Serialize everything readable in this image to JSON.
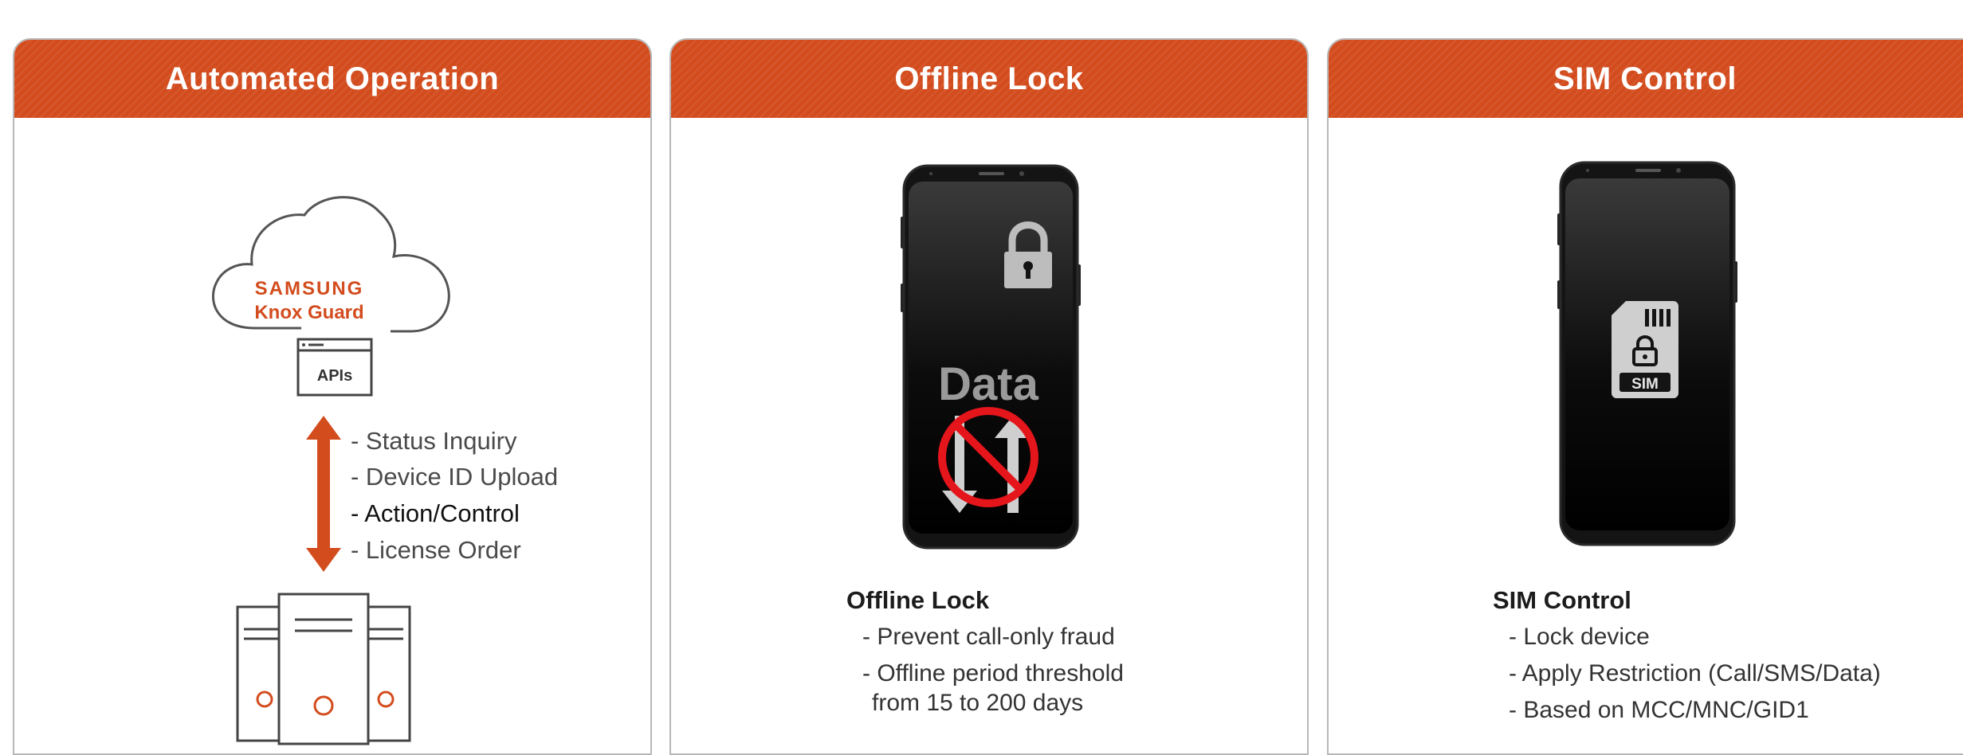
{
  "cards": [
    {
      "title": "Automated Operation",
      "cloud": {
        "brand": "SAMSUNG",
        "product": "Knox Guard",
        "api_label": "APIs"
      },
      "flows": [
        "- Status Inquiry",
        "- Device ID Upload",
        "- Action/Control",
        "- License Order"
      ]
    },
    {
      "title": "Offline Lock",
      "phone_text": "Data",
      "feature": {
        "title": "Offline Lock",
        "items": [
          "- Prevent call-only fraud",
          "- Offline period threshold",
          "from 15 to 200 days"
        ]
      }
    },
    {
      "title": "SIM Control",
      "sim_label": "SIM",
      "feature": {
        "title": "SIM Control",
        "items": [
          "- Lock device",
          "- Apply Restriction (Call/SMS/Data)",
          "- Based on MCC/MNC/GID1"
        ]
      }
    }
  ],
  "colors": {
    "accent": "#d34c1e",
    "border": "#b8b8b8",
    "phone": "#111111"
  },
  "icons": [
    "cloud-icon",
    "double-arrow-icon",
    "server-icon",
    "phone-icon",
    "padlock-icon",
    "no-sign-icon",
    "sim-card-icon"
  ]
}
